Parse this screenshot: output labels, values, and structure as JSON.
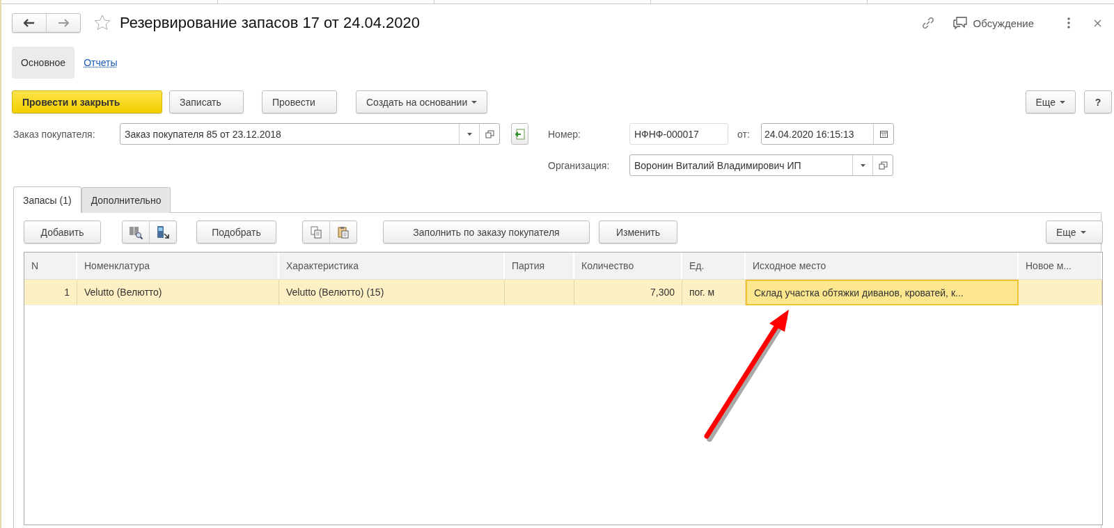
{
  "window": {
    "title": "Резервирование запасов 17 от 24.04.2020",
    "favorite": false
  },
  "header_actions": {
    "discussion": "Обсуждение"
  },
  "sections": [
    {
      "label": "Основное",
      "selected": true
    },
    {
      "label": "Отчеты",
      "selected": false
    }
  ],
  "command_bar": {
    "buttons": [
      {
        "label": "Провести и закрыть",
        "kind": "primary"
      },
      {
        "label": "Записать",
        "kind": "plain"
      },
      {
        "label": "Провести",
        "kind": "plain"
      },
      {
        "label": "Создать на основании",
        "kind": "dropdown"
      }
    ],
    "more": "Еще",
    "help": "?"
  },
  "fields": {
    "order": {
      "label": "Заказ покупателя:",
      "value": "Заказ покупателя 85 от 23.12.2018"
    },
    "number": {
      "label": "Номер:",
      "value": "НФНФ-000017"
    },
    "date": {
      "label": "от:",
      "value": "24.04.2020 16:15:13"
    },
    "organization": {
      "label": "Организация:",
      "value": "Воронин Виталий Владимирович ИП"
    }
  },
  "tabs": [
    {
      "label": "Запасы (1)",
      "selected": true
    },
    {
      "label": "Дополнительно",
      "selected": false
    }
  ],
  "table_toolbar": {
    "items": [
      {
        "kind": "button",
        "label": "Добавить"
      },
      {
        "kind": "scan-group"
      },
      {
        "kind": "button",
        "label": "Подобрать"
      },
      {
        "kind": "clipboard-group"
      },
      {
        "kind": "button",
        "label": "Заполнить по заказу покупателя"
      },
      {
        "kind": "button",
        "label": "Изменить"
      }
    ],
    "more": "Еще"
  },
  "table": {
    "columns": [
      {
        "label": "N"
      },
      {
        "label": "Номенклатура"
      },
      {
        "label": "Характеристика"
      },
      {
        "label": "Партия"
      },
      {
        "label": "Количество"
      },
      {
        "label": "Ед."
      },
      {
        "label": "Исходное место"
      },
      {
        "label": "Новое м..."
      }
    ],
    "rows": [
      {
        "selected": true,
        "cells": [
          {
            "text": "1",
            "focused": false
          },
          {
            "text": "Velutto (Велютто)",
            "focused": false
          },
          {
            "text": "Velutto (Велютто) (15)",
            "focused": false
          },
          {
            "focused": false
          },
          {
            "text": "7,300",
            "focused": false
          },
          {
            "text": "пог. м",
            "focused": false
          },
          {
            "text": "Склад участка обтяжки диванов, кроватей, к...",
            "focused": true
          },
          {
            "focused": false
          }
        ]
      }
    ]
  }
}
